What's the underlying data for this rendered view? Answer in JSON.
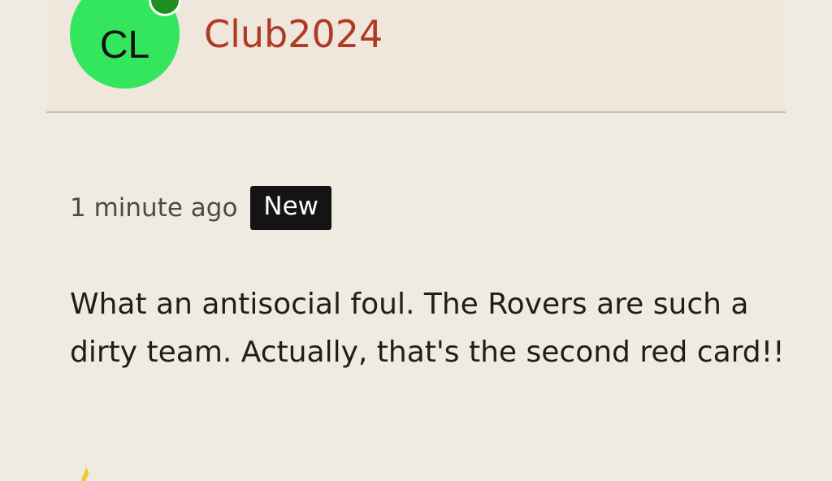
{
  "user": {
    "initials": "CL",
    "name": "Club2024",
    "avatar_color": "#33e65e",
    "status_color": "#1e8f1e",
    "name_color": "#b03a25"
  },
  "post": {
    "timestamp": "1 minute ago",
    "badge": "New",
    "text": "What an antisocial foul. The Rovers are such a dirty team. Actually, that's the second red card!!"
  },
  "icons": {
    "reaction": "thumbs-up-icon",
    "reaction_color": "#f2c935"
  }
}
